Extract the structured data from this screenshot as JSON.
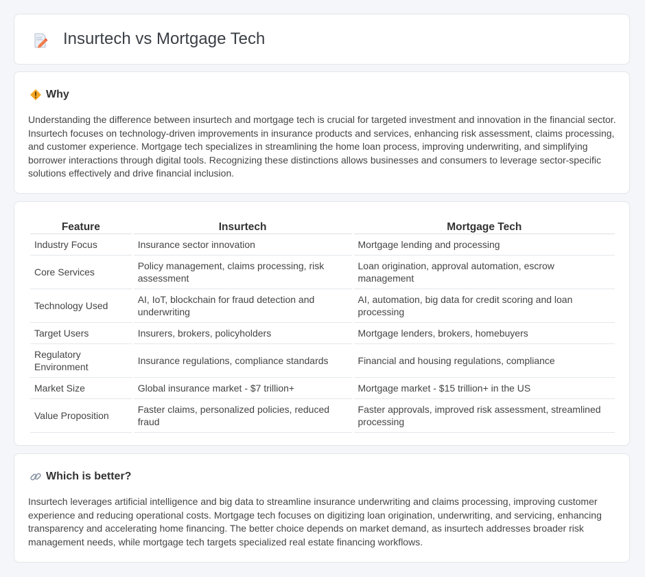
{
  "header": {
    "title": "Insurtech vs Mortgage Tech",
    "icon": "document-pencil-icon"
  },
  "why": {
    "title": "Why",
    "icon": "diamond-warning-icon",
    "text": "Understanding the difference between insurtech and mortgage tech is crucial for targeted investment and innovation in the financial sector. Insurtech focuses on technology-driven improvements in insurance products and services, enhancing risk assessment, claims processing, and customer experience. Mortgage tech specializes in streamlining the home loan process, improving underwriting, and simplifying borrower interactions through digital tools. Recognizing these distinctions allows businesses and consumers to leverage sector-specific solutions effectively and drive financial inclusion."
  },
  "table": {
    "headers": [
      "Feature",
      "Insurtech",
      "Mortgage Tech"
    ],
    "rows": [
      [
        "Industry Focus",
        "Insurance sector innovation",
        "Mortgage lending and processing"
      ],
      [
        "Core Services",
        "Policy management, claims processing, risk assessment",
        "Loan origination, approval automation, escrow management"
      ],
      [
        "Technology Used",
        "AI, IoT, blockchain for fraud detection and underwriting",
        "AI, automation, big data for credit scoring and loan processing"
      ],
      [
        "Target Users",
        "Insurers, brokers, policyholders",
        "Mortgage lenders, brokers, homebuyers"
      ],
      [
        "Regulatory Environment",
        "Insurance regulations, compliance standards",
        "Financial and housing regulations, compliance"
      ],
      [
        "Market Size",
        "Global insurance market - $7 trillion+",
        "Mortgage market - $15 trillion+ in the US"
      ],
      [
        "Value Proposition",
        "Faster claims, personalized policies, reduced fraud",
        "Faster approvals, improved risk assessment, streamlined processing"
      ]
    ]
  },
  "better": {
    "title": "Which is better?",
    "icon": "link-icon",
    "text": "Insurtech leverages artificial intelligence and big data to streamline insurance underwriting and claims processing, improving customer experience and reducing operational costs. Mortgage tech focuses on digitizing loan origination, underwriting, and servicing, enhancing transparency and accelerating home financing. The better choice depends on market demand, as insurtech addresses broader risk management needs, while mortgage tech targets specialized real estate financing workflows."
  }
}
